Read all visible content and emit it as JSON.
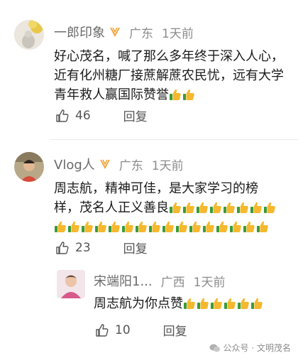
{
  "comments": [
    {
      "name": "一郎印象",
      "region": "广东",
      "time": "1天前",
      "text": "好心茂名，喊了那么多年终于深入人心，近有化州糖厂接蔗解蔗农民忧，远有大学青年救人赢国际赞誉",
      "thumbs": 2,
      "likes": "46",
      "reply_label": "回复"
    },
    {
      "name": "Vlog人",
      "region": "广东",
      "time": "1天前",
      "text": "周志航，精神可佳，是大家学习的榜样，茂名人正义善良",
      "thumbs": 24,
      "likes": "23",
      "reply_label": "回复"
    }
  ],
  "reply": {
    "name": "宋端阳1...",
    "region": "广西",
    "time": "1天前",
    "text": "周志航为你点赞",
    "thumbs": 6,
    "likes": "10",
    "reply_label": "回复"
  },
  "footer": {
    "text": "公众号 · 文明茂名"
  },
  "colors": {
    "name": "#6b6b6b",
    "meta": "#8c8c8c",
    "badge": "#f0a030",
    "thumb_yellow": "#f5b82e",
    "thumb_cuff": "#3a9b3a"
  }
}
